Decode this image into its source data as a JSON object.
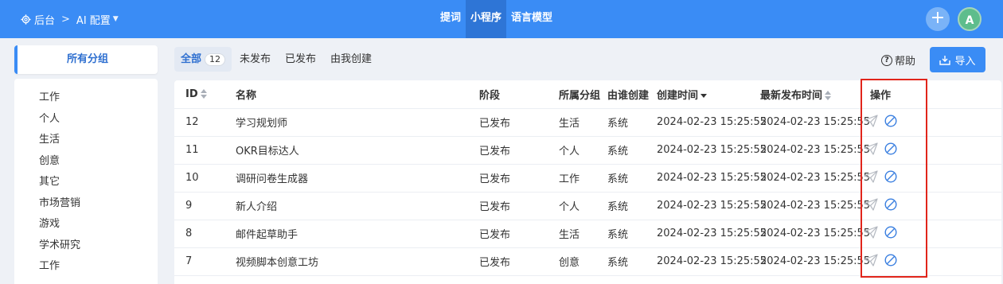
{
  "topbar": {
    "breadcrumb": {
      "home": "后台",
      "current": "AI 配置"
    },
    "tabs": [
      {
        "label": "提词",
        "active": false
      },
      {
        "label": "小程序",
        "active": true
      },
      {
        "label": "语言模型",
        "active": false
      }
    ],
    "avatar_letter": "A"
  },
  "sidebar": {
    "header": "所有分组",
    "items": [
      "工作",
      "个人",
      "生活",
      "创意",
      "其它",
      "市场营销",
      "游戏",
      "学术研究",
      "工作"
    ]
  },
  "subtabs": [
    {
      "label": "全部",
      "count": "12",
      "active": true
    },
    {
      "label": "未发布",
      "active": false
    },
    {
      "label": "已发布",
      "active": false
    },
    {
      "label": "由我创建",
      "active": false
    }
  ],
  "toolbar": {
    "help_label": "帮助",
    "import_label": "导入"
  },
  "table": {
    "columns": {
      "id": "ID",
      "name": "名称",
      "stage": "阶段",
      "group": "所属分组",
      "creator": "由谁创建",
      "created": "创建时间",
      "published": "最新发布时间",
      "actions": "操作"
    },
    "rows": [
      {
        "id": "12",
        "name": "学习规划师",
        "stage": "已发布",
        "group": "生活",
        "creator": "系统",
        "created": "2024-02-23 15:25:55",
        "published": "2024-02-23 15:25:55"
      },
      {
        "id": "11",
        "name": "OKR目标达人",
        "stage": "已发布",
        "group": "个人",
        "creator": "系统",
        "created": "2024-02-23 15:25:55",
        "published": "2024-02-23 15:25:55"
      },
      {
        "id": "10",
        "name": "调研问卷生成器",
        "stage": "已发布",
        "group": "工作",
        "creator": "系统",
        "created": "2024-02-23 15:25:55",
        "published": "2024-02-23 15:25:55"
      },
      {
        "id": "9",
        "name": "新人介绍",
        "stage": "已发布",
        "group": "个人",
        "creator": "系统",
        "created": "2024-02-23 15:25:55",
        "published": "2024-02-23 15:25:55"
      },
      {
        "id": "8",
        "name": "邮件起草助手",
        "stage": "已发布",
        "group": "生活",
        "creator": "系统",
        "created": "2024-02-23 15:25:55",
        "published": "2024-02-23 15:25:55"
      },
      {
        "id": "7",
        "name": "视频脚本创意工坊",
        "stage": "已发布",
        "group": "创意",
        "creator": "系统",
        "created": "2024-02-23 15:25:55",
        "published": "2024-02-23 15:25:55"
      }
    ]
  },
  "colors": {
    "primary": "#3a8cf5",
    "highlight": "#e1251b",
    "ban_icon": "#3a7fe0"
  },
  "icons": {
    "row_actions": [
      "send-icon",
      "ban-icon"
    ]
  }
}
